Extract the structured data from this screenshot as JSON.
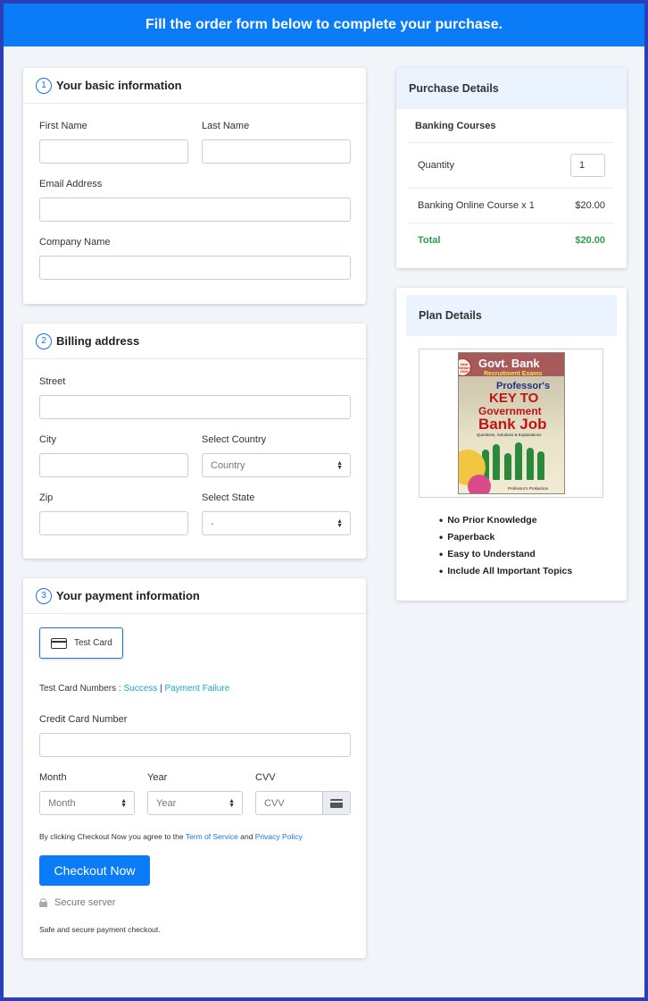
{
  "banner": {
    "text": "Fill the order form below to complete your purchase."
  },
  "basic": {
    "step": "1",
    "title": "Your basic information",
    "first_name_label": "First Name",
    "last_name_label": "Last Name",
    "email_label": "Email Address",
    "company_label": "Company Name"
  },
  "billing": {
    "step": "2",
    "title": "Billing address",
    "street_label": "Street",
    "city_label": "City",
    "country_label": "Select Country",
    "country_value": "Country",
    "zip_label": "Zip",
    "state_label": "Select State",
    "state_value": "-"
  },
  "payment": {
    "step": "3",
    "title": "Your payment information",
    "test_card_label": "Test Card",
    "test_numbers_prefix": "Test Card Numbers :",
    "success_link": "Success",
    "separator": "|",
    "failure_link": "Payment Failure",
    "card_number_label": "Credit Card Number",
    "month_label": "Month",
    "month_value": "Month",
    "year_label": "Year",
    "year_value": "Year",
    "cvv_label": "CVV",
    "cvv_placeholder": "CVV",
    "terms_prefix": "By clicking Checkout Now you agree to the",
    "terms_link": "Term of Service",
    "terms_and": "and",
    "privacy_link": "Privacy Policy",
    "checkout_button": "Checkout Now",
    "secure_server": "Secure server",
    "safe_text": "Safe and secure payment checkout."
  },
  "purchase": {
    "title": "Purchase Details",
    "product": "Banking Courses",
    "quantity_label": "Quantity",
    "quantity_value": "1",
    "line_item": "Banking Online Course x 1",
    "line_price": "$20.00",
    "total_label": "Total",
    "total_value": "$20.00"
  },
  "plan": {
    "title": "Plan Details",
    "book": {
      "edition": "New Edition 2020",
      "line1": "Govt. Bank",
      "line2": "Recruitment Exams",
      "line3": "Professor's",
      "line4": "KEY TO",
      "line5": "Government",
      "line6": "Bank Job",
      "line7": "Questions, Solutions & Explanations",
      "publisher": "Professor's Prokashon"
    },
    "features": [
      "No Prior Knowledge",
      "Paperback",
      "Easy to Understand",
      "Include All Important Topics"
    ]
  },
  "colors": {
    "accent": "#0a7cf7",
    "total_green": "#2e9e4f",
    "link": "#1aa7c9"
  }
}
